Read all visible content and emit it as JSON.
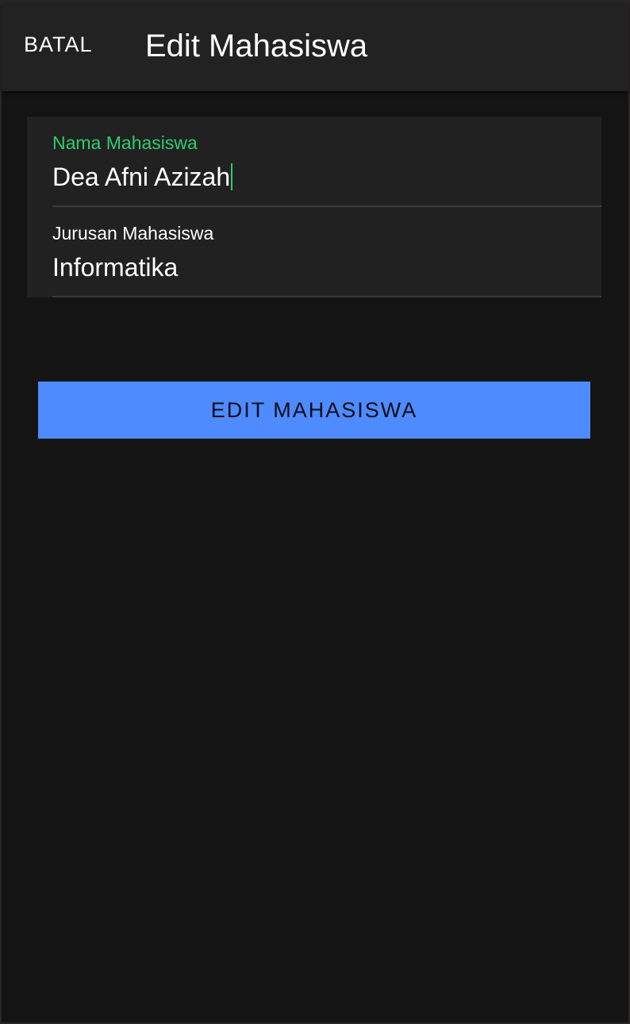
{
  "app_bar": {
    "cancel_label": "BATAL",
    "title": "Edit Mahasiswa"
  },
  "form": {
    "name_field": {
      "label": "Nama Mahasiswa",
      "value": "Dea Afni Azizah",
      "focused": true
    },
    "major_field": {
      "label": "Jurusan Mahasiswa",
      "value": "Informatika",
      "focused": false
    }
  },
  "submit_label": "EDIT MAHASISWA",
  "colors": {
    "accent_focus": "#2ecc71",
    "button": "#4d8bff",
    "background": "#141414",
    "surface": "#222222"
  }
}
